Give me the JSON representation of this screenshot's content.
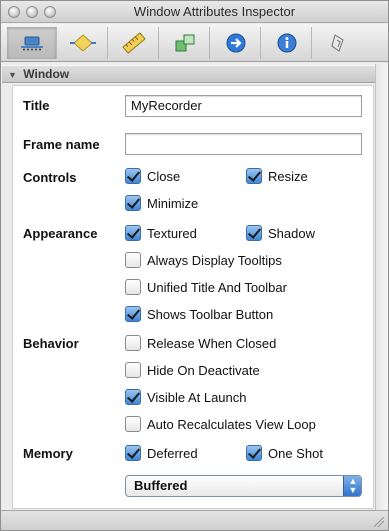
{
  "window": {
    "title": "Window Attributes Inspector"
  },
  "toolbar": {
    "tabs": [
      {
        "icon": "attributes-icon"
      },
      {
        "icon": "effects-icon"
      },
      {
        "icon": "size-ruler-icon"
      },
      {
        "icon": "bindings-icon"
      },
      {
        "icon": "connections-arrow-icon"
      },
      {
        "icon": "info-icon"
      },
      {
        "icon": "applescript-icon"
      }
    ]
  },
  "section": {
    "title": "Window",
    "disclosure": "▼"
  },
  "form": {
    "title_label": "Title",
    "title_value": "MyRecorder",
    "frame_label": "Frame name",
    "frame_value": "",
    "controls_label": "Controls",
    "appearance_label": "Appearance",
    "behavior_label": "Behavior",
    "memory_label": "Memory",
    "checkboxes": {
      "close": {
        "label": "Close",
        "checked": true
      },
      "resize": {
        "label": "Resize",
        "checked": true
      },
      "minimize": {
        "label": "Minimize",
        "checked": true
      },
      "textured": {
        "label": "Textured",
        "checked": true
      },
      "shadow": {
        "label": "Shadow",
        "checked": true
      },
      "tooltips": {
        "label": "Always Display Tooltips",
        "checked": false
      },
      "unified": {
        "label": "Unified Title And Toolbar",
        "checked": false
      },
      "toolbar_button": {
        "label": "Shows Toolbar Button",
        "checked": true
      },
      "release": {
        "label": "Release When Closed",
        "checked": false
      },
      "hide": {
        "label": "Hide On Deactivate",
        "checked": false
      },
      "visible": {
        "label": "Visible At Launch",
        "checked": true
      },
      "recalc": {
        "label": "Auto Recalculates View Loop",
        "checked": false
      },
      "deferred": {
        "label": "Deferred",
        "checked": true
      },
      "oneshot": {
        "label": "One Shot",
        "checked": true
      }
    },
    "backing": {
      "selected": "Buffered",
      "arrows": "▲▼"
    }
  },
  "colors": {
    "accent": "#3f86d6",
    "chrome": "#ececec"
  }
}
